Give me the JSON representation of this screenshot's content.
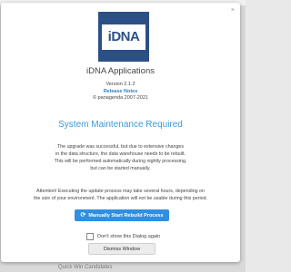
{
  "dialog": {
    "close_symbol": "×",
    "logo_text": "iDNA",
    "app_name": "iDNA Applications",
    "version": "Version 2.1.2",
    "release_notes": "Release Notes",
    "copyright": "© panagenda 2007-2021",
    "heading": "System Maintenance Required",
    "message_lines": [
      "The upgrade was successful, but due to extensive changes",
      "in the data structure, the data warehouse needs to be rebuilt.",
      "This will be performed automatically during nightly processing,",
      "but can be started manually."
    ],
    "attention_lines": [
      "Attention! Executing the update process may take several hours, depending on",
      "the size of your environment. The application will not be usable during this period."
    ],
    "rebuild_icon": "⟳",
    "rebuild_button": "Manually Start Rebuild Process",
    "dont_show_label": "Don't show this Dialog again",
    "dismiss_button": "Dismiss Window"
  },
  "background": {
    "partial_text": "Quick Win Candidates"
  },
  "colors": {
    "accent": "#3a9ad9",
    "primary_button": "#2f8fe0",
    "logo_bg": "#2c4f86"
  }
}
